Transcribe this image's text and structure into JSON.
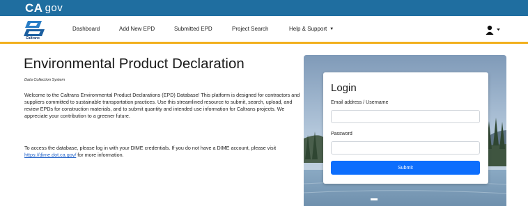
{
  "topbar": {
    "logo_main": "CA",
    "logo_suffix": "gov"
  },
  "navbar": {
    "brand_text": "Caltrans",
    "items": [
      {
        "label": "Dashboard"
      },
      {
        "label": "Add New EPD"
      },
      {
        "label": "Submitted EPD"
      },
      {
        "label": "Project Search"
      },
      {
        "label": "Help & Support"
      }
    ],
    "user_icon": "user-icon"
  },
  "main": {
    "title": "Environmental Product Declaration",
    "subtitle": "Data Collection System",
    "paragraph1": "Welcome to the Caltrans Environmental Product Declarations (EPD) Database! This platform is designed for contractors and suppliers committed to sustainable transportation practices. Use this streamlined resource to submit, search, upload, and review EPDs for construction materials, and to submit quantity and intended use information for Caltrans projects. We appreciate your contribution to a greener future.",
    "paragraph2_before": "To access the database, please log in with your DIME credentials. If you do not have a DIME account, please visit ",
    "paragraph2_link": "https://dime.dot.ca.gov/",
    "paragraph2_after": " for more information."
  },
  "login": {
    "title": "Login",
    "email_label": "Email address / Username",
    "email_value": "",
    "password_label": "Password",
    "password_value": "",
    "submit_label": "Submit"
  },
  "colors": {
    "topbar": "#1f6ea0",
    "accent_border": "#f2b01e",
    "button": "#0d6efd",
    "link": "#1d5fc7"
  }
}
